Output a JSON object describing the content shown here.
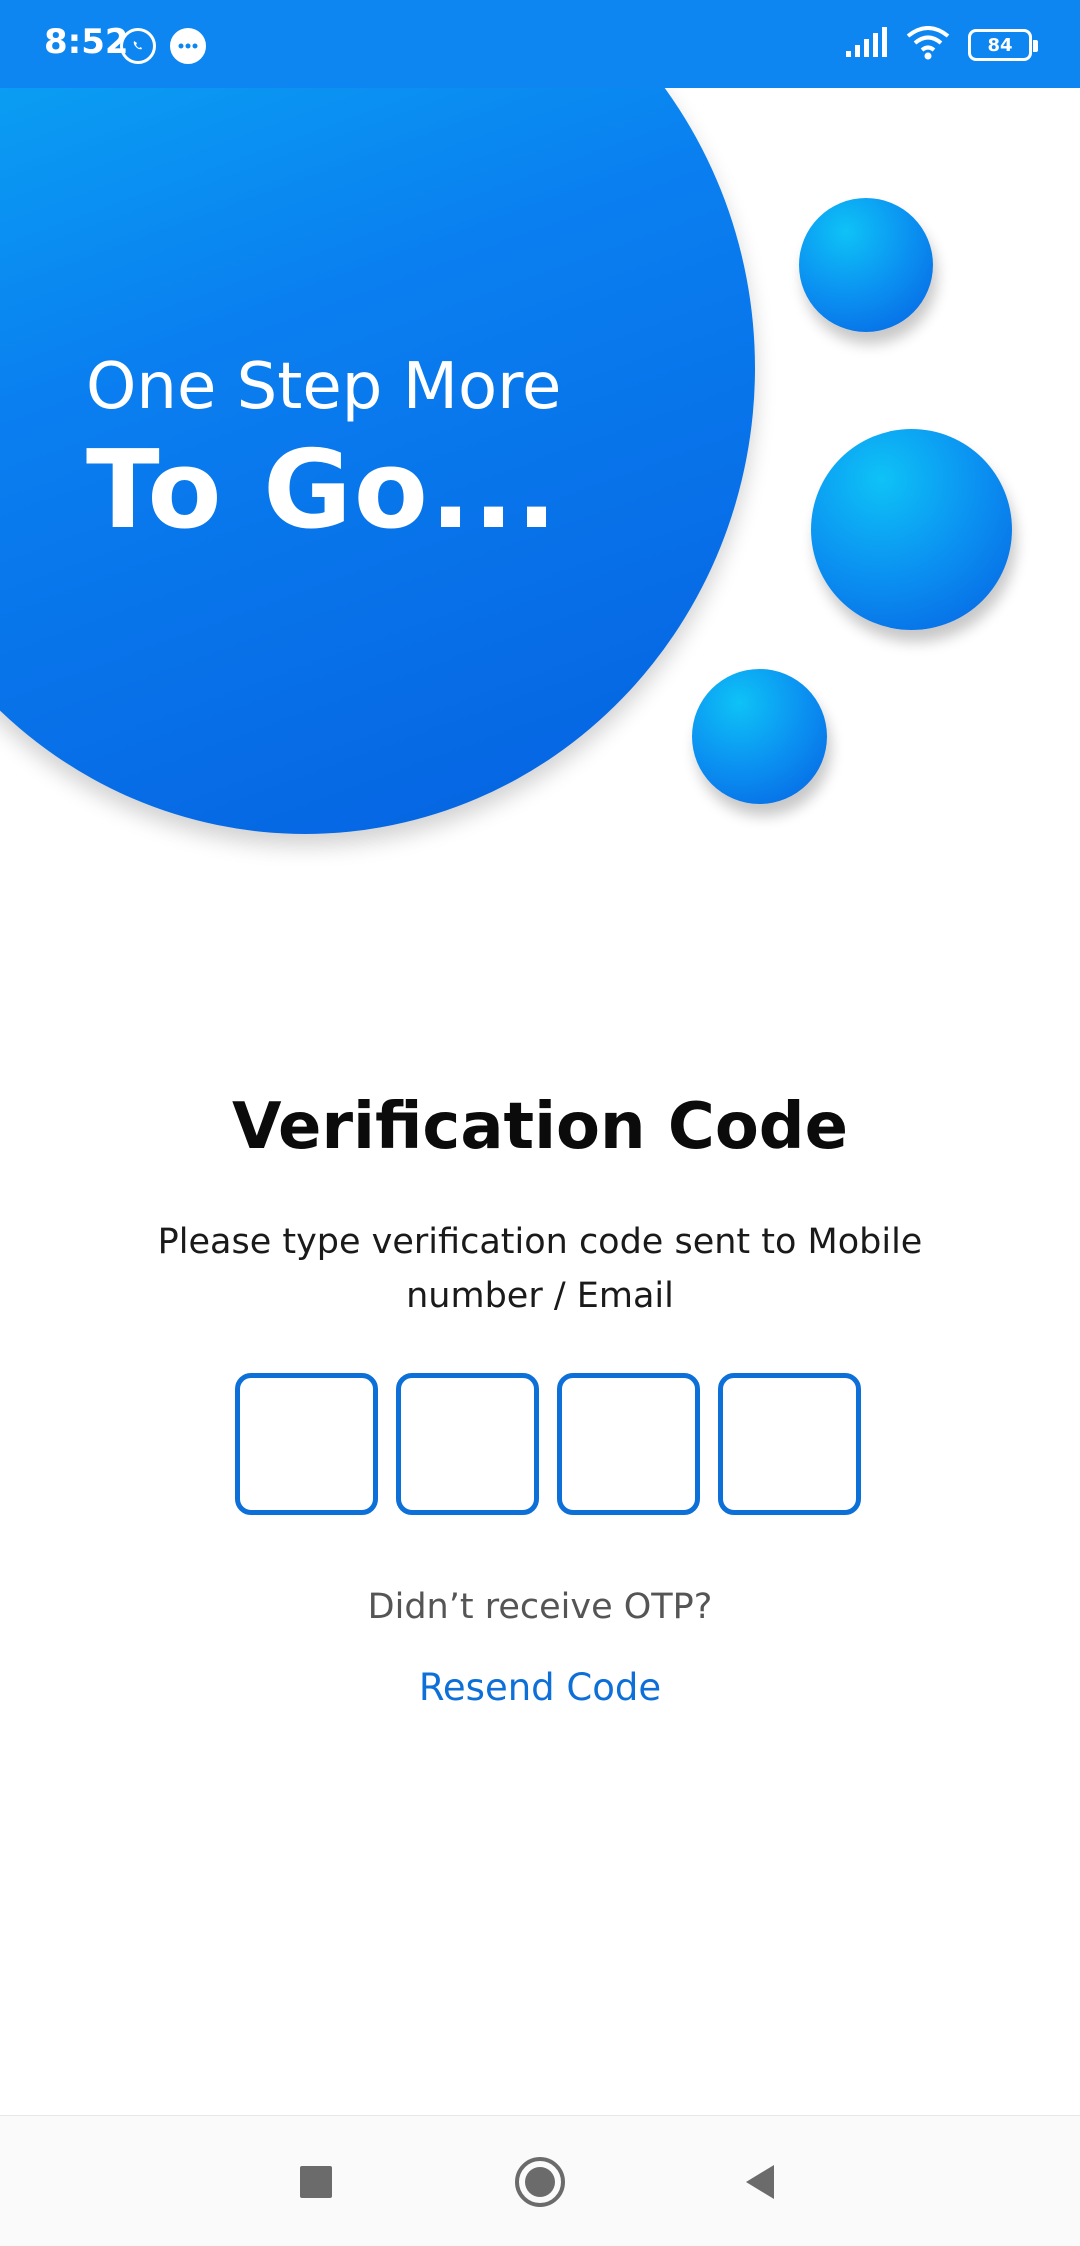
{
  "status_bar": {
    "time": "8:52",
    "battery": "84",
    "icons": [
      "whatsapp-icon",
      "message-icon",
      "signal-icon",
      "wifi-icon",
      "battery-icon"
    ]
  },
  "hero": {
    "line1": "One Step More",
    "line2": "To Go..."
  },
  "verification": {
    "title": "Verification Code",
    "subtitle": "Please type verification code sent to Mobile number / Email",
    "otp_digits": [
      "",
      "",
      "",
      ""
    ],
    "no_otp_text": "Didn’t receive OTP?",
    "resend_label": "Resend Code"
  },
  "nav_bar": {
    "buttons": [
      "recent-apps",
      "home",
      "back"
    ]
  },
  "colors": {
    "status_bar": "#0d86f2",
    "accent": "#0d6fd8",
    "hero_gradient_start": "#0ab3f5",
    "hero_gradient_end": "#0561e0"
  }
}
